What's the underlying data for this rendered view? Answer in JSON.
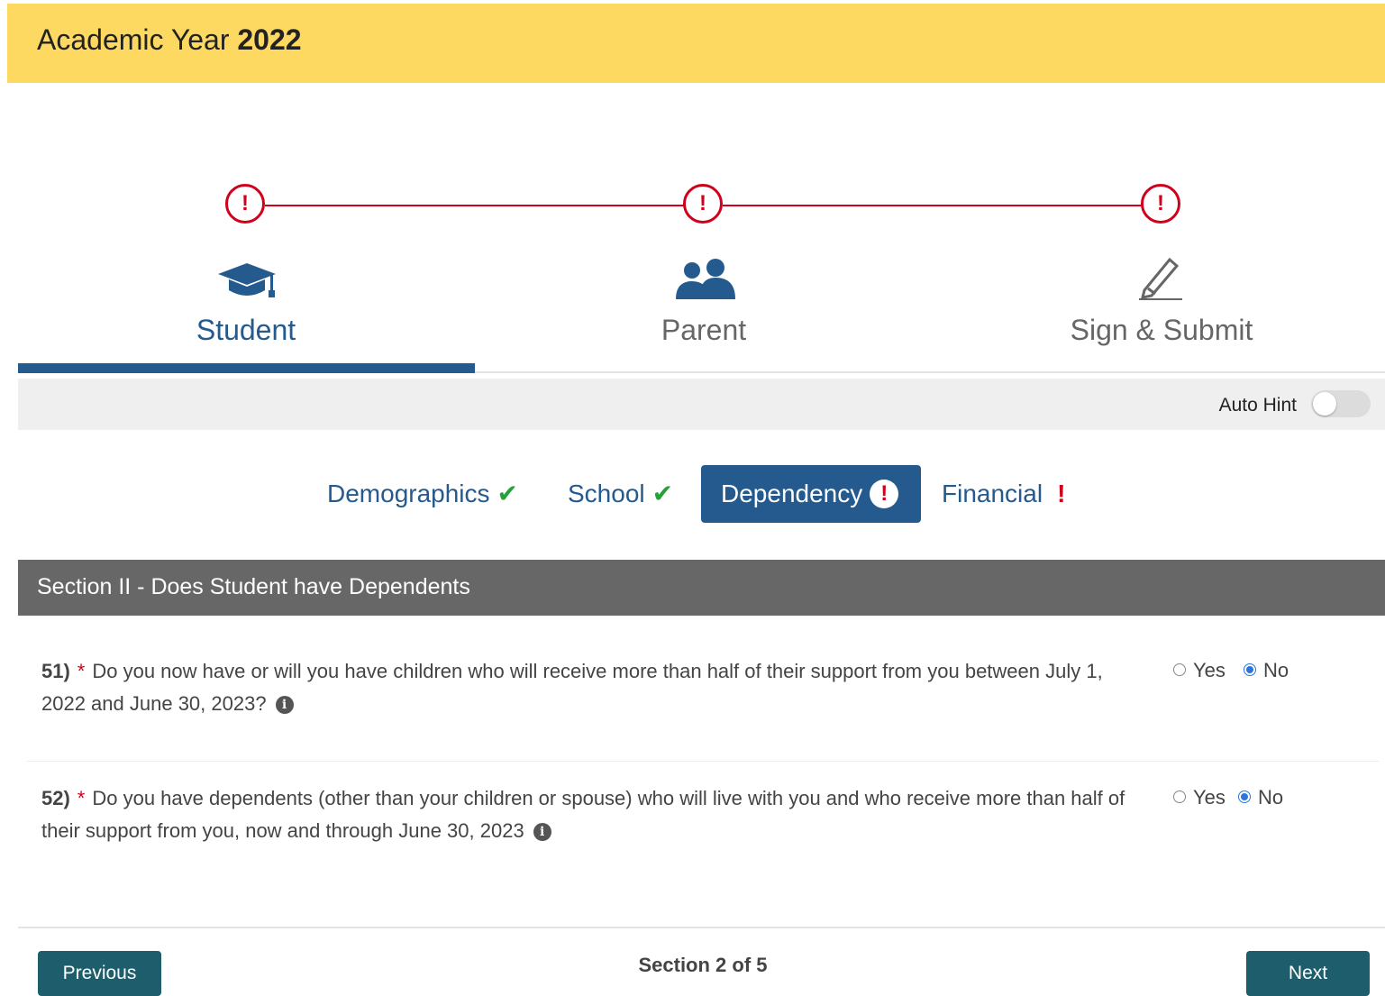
{
  "header": {
    "title_prefix": "Academic Year",
    "title_year": "2022"
  },
  "stepper": {
    "steps": [
      {
        "label": "Student",
        "status_icon": "!",
        "icon": "graduation-cap-icon",
        "active": true
      },
      {
        "label": "Parent",
        "status_icon": "!",
        "icon": "users-icon",
        "active": false
      },
      {
        "label": "Sign & Submit",
        "status_icon": "!",
        "icon": "pencil-icon",
        "active": false
      }
    ],
    "status_color": "#d0021b",
    "active_color": "#245a8e"
  },
  "hint_bar": {
    "label": "Auto Hint",
    "toggle_on": false
  },
  "subtabs": [
    {
      "label": "Demographics",
      "status": "✔"
    },
    {
      "label": "School",
      "status": "✔"
    },
    {
      "label": "Dependency",
      "status": "!"
    },
    {
      "label": "Financial",
      "status": "!"
    }
  ],
  "section": {
    "title": "Section II - Does Student have Dependents"
  },
  "questions": [
    {
      "number": "51)",
      "required": "*",
      "text": "Do you now have or will you have children who will receive more than half of their support from you between July 1, 2022 and June 30, 2023?",
      "info": "i",
      "options": [
        "Yes",
        "No"
      ],
      "selected": "No"
    },
    {
      "number": "52)",
      "required": "*",
      "text": "Do you have dependents (other than your children or spouse) who will live with you and who receive more than half of their support from you, now and through June 30, 2023",
      "info": "i",
      "options": [
        "Yes",
        "No"
      ],
      "selected": "No"
    }
  ],
  "footer": {
    "previous_label": "Previous",
    "next_label": "Next",
    "section_count": "Section 2 of 5"
  }
}
